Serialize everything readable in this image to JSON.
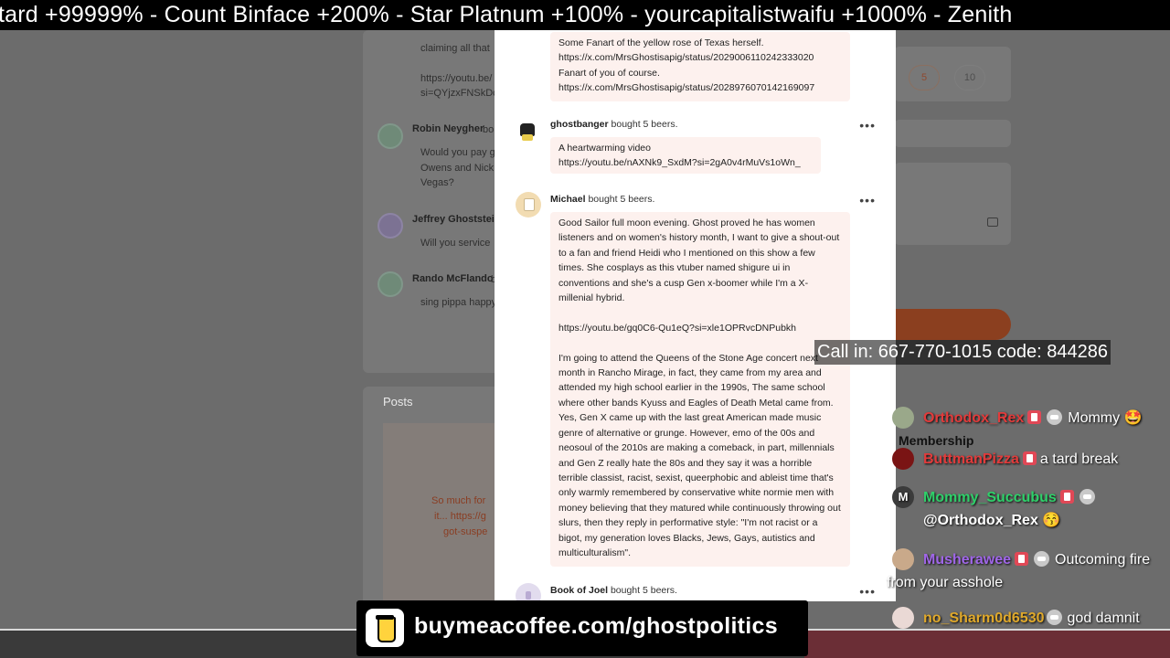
{
  "ticker": {
    "text": "tard +99999% - Count Binface +200%  -  Star Platnum +100%   -   yourcapitalistwaifu +1000%  -  Zenith"
  },
  "background": {
    "posts_label": "Posts",
    "pagination": [
      "5",
      "10"
    ],
    "comments": [
      {
        "name": "",
        "lines": [
          "claiming all that",
          "",
          "https://youtu.be/",
          "si=QYjzxFNSkDc"
        ]
      },
      {
        "name": "Robin Neygher",
        "name_suffix": "bo",
        "lines": [
          "Would you pay g",
          "Owens and Nick",
          "Vegas?"
        ]
      },
      {
        "name": "Jeffrey Ghoststein",
        "name_suffix": "",
        "lines": [
          "Will you service"
        ]
      },
      {
        "name": "Rando McFlando",
        "name_suffix": "b",
        "lines": [
          "sing pippa happy"
        ]
      }
    ],
    "post_preview": [
      "So much for",
      "it... https://g",
      "got-suspe"
    ]
  },
  "supporters": [
    {
      "name": "",
      "action": "",
      "message": "Some Fanart of the yellow rose of Texas herself.\nhttps://x.com/MrsGhostisapig/status/2029006110242333020\nFanart of you of course.\nhttps://x.com/MrsGhostisapig/status/2028976070142169097"
    },
    {
      "name": "ghostbanger",
      "action": "bought 5 beers.",
      "message": "A heartwarming video\nhttps://youtu.be/nAXNk9_SxdM?si=2gA0v4rMuVs1oWn_"
    },
    {
      "name": "Michael",
      "action": "bought 5 beers.",
      "message": "Good Sailor full moon evening. Ghost proved he has women listeners and on women's history month, I want to give a shout-out to a fan and friend Heidi who I mentioned on this show a few times. She cosplays as this vtuber named shigure ui in conventions and she's a cusp Gen x-boomer while I'm a X-millenial hybrid.\n\nhttps://youtu.be/gq0C6-Qu1eQ?si=xle1OPRvcDNPubkh\n\nI'm going to attend the Queens of the Stone Age concert next month in Rancho Mirage, in fact, they came from my area and attended my high school earlier in the 1990s, The same school where other bands Kyuss and Eagles of Death Metal came from. Yes, Gen X came up with the last great American made music genre of alternative or grunge. However, emo of the 00s and neosoul of the 2010s are making a comeback, in part, millennials and Gen Z really hate the 80s and they say it was a horrible terrible classist, racist, sexist, queerphobic and ableist time that's only warmly remembered by conservative white normie men with money believing that they matured while continuously throwing out slurs, then they reply in performative style: \"I'm not racist or a bigot, my generation loves Blacks, Jews, Gays, autistics and multiculturalism\"."
    },
    {
      "name": "Book of Joel",
      "action": "bought 5 beers.",
      "message": ""
    }
  ],
  "more_icon": "•••",
  "callin": "Call in: 667-770-1015 code: 844286",
  "chat": {
    "membership_label": "Membership",
    "messages": [
      {
        "user": "Orthodox_Rex",
        "user_color": "#e23b3b",
        "text": "Mommy 🤩"
      },
      {
        "user": "ButtmanPizza",
        "user_color": "#e23b3b",
        "text": "a tard break"
      },
      {
        "user": "Mommy_Succubus",
        "user_color": "#2fd06a",
        "text": "@Orthodox_Rex 😚"
      },
      {
        "user": "Musherawee",
        "user_color": "#a066e8",
        "text": "Outcoming fire from your asshole"
      },
      {
        "user": "no_Sharm0d6530",
        "user_color": "#e0a92b",
        "text": "god damnit"
      }
    ]
  },
  "banner": {
    "url": "buymeacoffee.com/ghostpolitics"
  },
  "colors": {
    "accent": "#e8623a",
    "bubble": "#fdf1ee"
  }
}
